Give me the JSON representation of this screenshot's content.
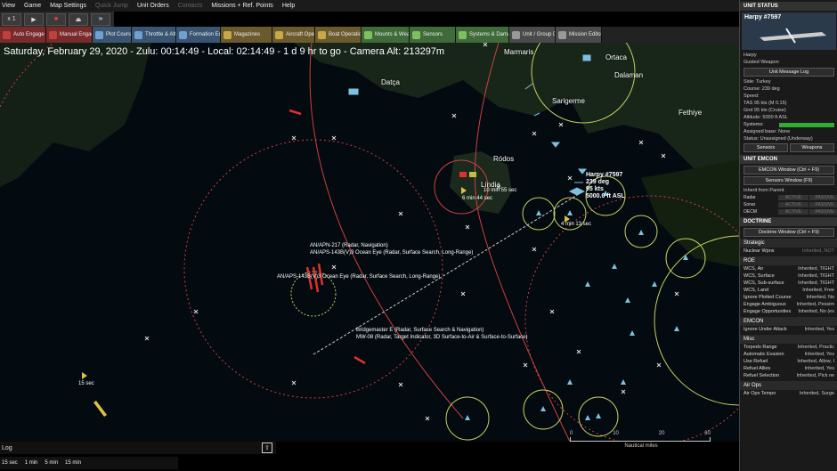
{
  "menu": [
    "View",
    "Game",
    "Map Settings",
    "Quick Jump",
    "Unit Orders",
    "Contacts",
    "Missions + Ref. Points",
    "Help"
  ],
  "controls": [
    "x 1",
    "▶",
    "■",
    "⏏",
    "⚑"
  ],
  "toolbar": [
    {
      "label": "Auto Engage Target",
      "color": "#7a2a2a",
      "icon": "#c04040"
    },
    {
      "label": "Manual Engage Target",
      "color": "#7a2a2a",
      "icon": "#c04040"
    },
    {
      "label": "Plot Course",
      "color": "#3a5572",
      "icon": "#6fa0d0"
    },
    {
      "label": "Throttle & Altitude",
      "color": "#3a5572",
      "icon": "#6fa0d0"
    },
    {
      "label": "Formation Editor",
      "color": "#3a5572",
      "icon": "#6fa0d0"
    },
    {
      "label": "Magazines",
      "color": "#6b5a2e",
      "icon": "#c8a848"
    },
    {
      "label": "Aircraft Operations",
      "color": "#6b5a2e",
      "icon": "#c8a848"
    },
    {
      "label": "Boat Operations",
      "color": "#6b5a2e",
      "icon": "#c8a848"
    },
    {
      "label": "Mounts & Weapons",
      "color": "#3f6b3a",
      "icon": "#7ec060"
    },
    {
      "label": "Sensors",
      "color": "#3f6b3a",
      "icon": "#7ec060"
    },
    {
      "label": "Systems & Damage",
      "color": "#3f6b3a",
      "icon": "#7ec060"
    },
    {
      "label": "Unit / Group Doctrine",
      "color": "#4a4a4a",
      "icon": "#999999"
    },
    {
      "label": "Mission Editor",
      "color": "#4a4a4a",
      "icon": "#999999"
    }
  ],
  "clock": "Saturday, February 29, 2020 - Zulu: 00:14:49 - Local: 02:14:49 - 1 d 9 hr to go -  Camera Alt: 213297m",
  "places": {
    "marmaris": "Marmaris",
    "datca": "Datça",
    "ortaca": "Ortaca",
    "dalaman": "Dalaman",
    "fethiye": "Fethiye",
    "sarigerme": "Sarigerme",
    "rodos": "Ródos",
    "linta": "Líndia"
  },
  "harpy": {
    "name": "Harpy #7597",
    "course": "239 deg",
    "speed": "95 kts",
    "alt": "5000.0 ft ASL"
  },
  "labels": {
    "min1": "10 min 55 sec",
    "min2": "6 min 44 sec",
    "min3": "4 min 13 sec",
    "sec15": "15 sec",
    "radar1": "AN/APN-217 (Radar, Navigation)",
    "radar2": "AN/APS-143B(V)3 Ocean Eye (Radar, Surface Search, Long-Range)",
    "radar3": "AN/APS-143B(V)3 Ocean Eye (Radar, Surface Search, Long-Range)",
    "radar4": "Bridgemaster E (Radar, Surface Search & Navigation)",
    "radar5": "MW-08 (Radar, Target Indicator, 3D Surface-to-Air & Surface-to-Surface)"
  },
  "msgbar": "Log",
  "timesteps": [
    "15 sec",
    "1 min",
    "5 min",
    "15 min"
  ],
  "scale": {
    "ticks": [
      "0",
      "10",
      "20",
      "30"
    ],
    "unit": "Nautical miles"
  },
  "panel": {
    "status_header": "UNIT STATUS",
    "unit_name": "Harpy #7597",
    "unit_class": "Harpy",
    "unit_type": "Guided Weapon",
    "msg_log": "Unit Message Log",
    "side": "Side: Turkey",
    "course": "Course: 239 deg",
    "speed_hdr": "Speed:",
    "tas": "TAS 95 kts (M 0.15)",
    "gnd": "Gnd 95 kts (Cruise)",
    "alt": "Altitude: 5000 ft ASL",
    "systems": "Systems:",
    "assigned": "Assigned base: None",
    "status": "Status: Unassigned (Underway)",
    "sensors_btn": "Sensors",
    "weapons_btn": "Weapons",
    "emcon_header": "UNIT EMCON",
    "emcon_btn": "EMCON Window (Ctrl + F9)",
    "sensors_window": "Sensors Window (F9)",
    "inherit": "Inherit from Parent",
    "emcon_rows": [
      {
        "name": "Radar",
        "a": "ACTIVE",
        "p": "PASSIVE"
      },
      {
        "name": "Sonar",
        "a": "ACTIVE",
        "p": "PASSIVE"
      },
      {
        "name": "OECM",
        "a": "ACTIVE",
        "p": "PASSIVE"
      }
    ],
    "doctrine_header": "DOCTRINE",
    "doctrine_btn": "Doctrine Window (Ctrl + F9)",
    "strategic": "Strategic",
    "nuclear": {
      "k": "Nuclear Wpns",
      "v": "Inherited, NOT"
    },
    "roe": "ROE",
    "roe_rows": [
      {
        "k": "WCS, Air",
        "v": "Inherited, TIGHT"
      },
      {
        "k": "WCS, Surface",
        "v": "Inherited, TIGHT"
      },
      {
        "k": "WCS, Sub-surface",
        "v": "Inherited, TIGHT"
      },
      {
        "k": "WCS, Land",
        "v": "Inherited, Free"
      },
      {
        "k": "Ignore Plotted Course",
        "v": "Inherited, No"
      },
      {
        "k": "Engage Ambiguous",
        "v": "Inherited, Pessim"
      },
      {
        "k": "Engage Opportunities",
        "v": "Inherited, No (ex"
      }
    ],
    "emcon2": "EMCON",
    "ignore_attack": {
      "k": "Ignore Under Attack",
      "v": "Inherited, Yes"
    },
    "misc": "Misc",
    "misc_rows": [
      {
        "k": "Torpedo Range",
        "v": "Inherited, Practic"
      },
      {
        "k": "Automatic Evasion",
        "v": "Inherited, Yes"
      },
      {
        "k": "Use Refuel",
        "v": "Inherited, Allow, I"
      },
      {
        "k": "Refuel Allies",
        "v": "Inherited, Yes"
      },
      {
        "k": "Refuel Selection",
        "v": "Inherited, Pick ne"
      }
    ],
    "airops": "Air Ops",
    "airops_row": {
      "k": "Air Ops Tempo",
      "v": "Inherited, Surge"
    }
  },
  "colors": {
    "range_ring": "#d04040",
    "friendly": "#7ec0e0",
    "hostile": "#e03030",
    "neutral": "#e0c040",
    "sensor": "#c8d060"
  }
}
